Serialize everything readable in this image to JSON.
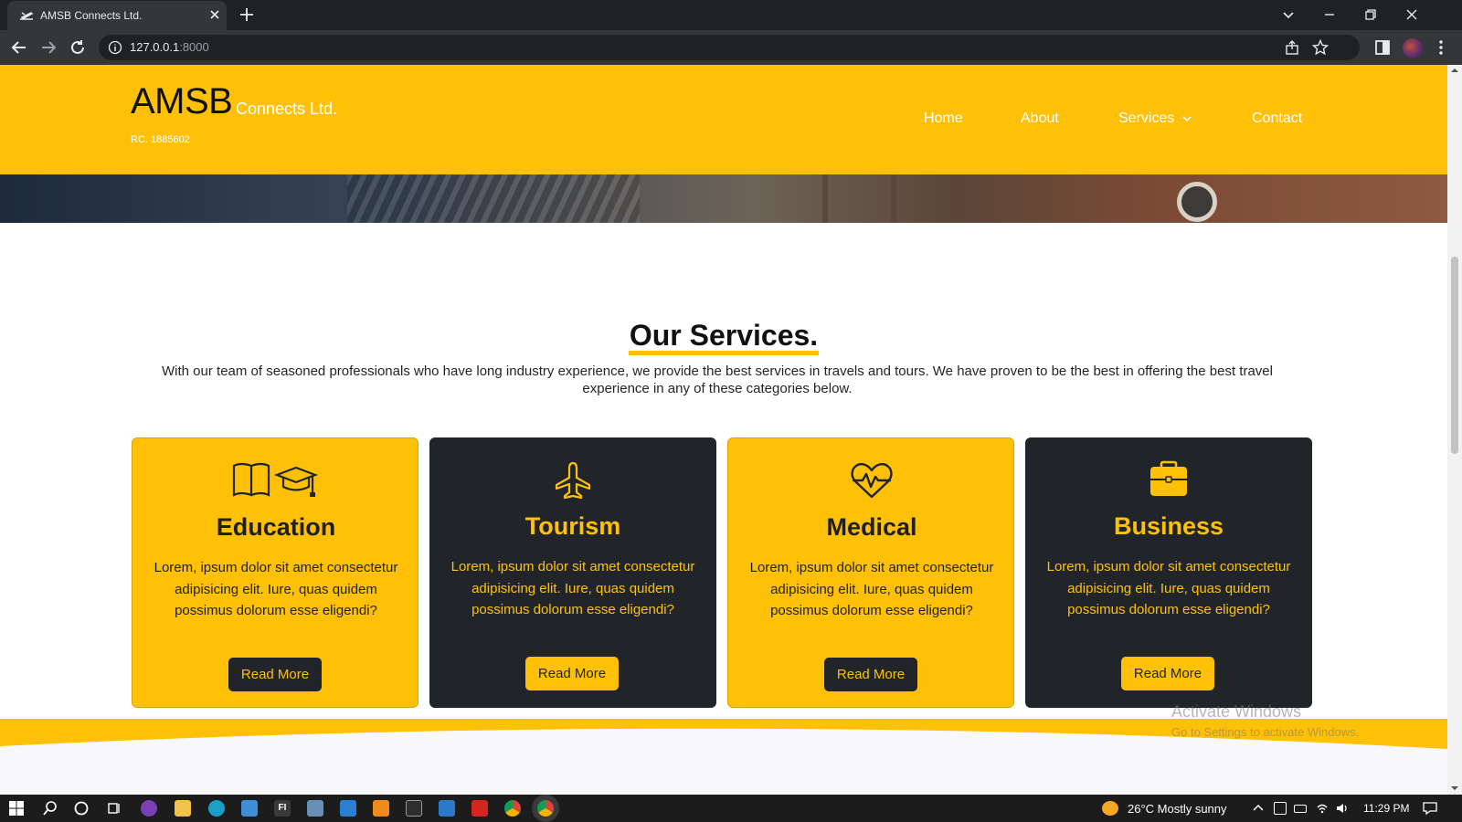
{
  "browser": {
    "tab_title": "AMSB Connects Ltd.",
    "url_host": "127.0.0.1",
    "url_port": ":8000"
  },
  "site": {
    "logo_main": "AMSB",
    "logo_sub": "Connects Ltd.",
    "logo_rc": "RC. 1885602",
    "nav": {
      "home": "Home",
      "about": "About",
      "services": "Services",
      "contact": "Contact"
    }
  },
  "services": {
    "title": "Our Services.",
    "description": "With our team of seasoned professionals who have long industry experience, we provide the best services in travels and tours. We have proven to be the best in offering the best travel experience in any of these categories below.",
    "cards": [
      {
        "title": "Education",
        "text": "Lorem, ipsum dolor sit amet consectetur adipisicing elit. Iure, quas quidem possimus dolorum esse eligendi?",
        "button": "Read More",
        "icon": "book-graduation-icon",
        "theme": "yellow"
      },
      {
        "title": "Tourism",
        "text": "Lorem, ipsum dolor sit amet consectetur adipisicing elit. Iure, quas quidem possimus dolorum esse eligendi?",
        "button": "Read More",
        "icon": "airplane-icon",
        "theme": "dark"
      },
      {
        "title": "Medical",
        "text": "Lorem, ipsum dolor sit amet consectetur adipisicing elit. Iure, quas quidem possimus dolorum esse eligendi?",
        "button": "Read More",
        "icon": "heart-pulse-icon",
        "theme": "yellow"
      },
      {
        "title": "Business",
        "text": "Lorem, ipsum dolor sit amet consectetur adipisicing elit. Iure, quas quidem possimus dolorum esse eligendi?",
        "button": "Read More",
        "icon": "briefcase-icon",
        "theme": "dark"
      }
    ]
  },
  "watermark": {
    "title": "Activate Windows",
    "subtitle": "Go to Settings to activate Windows."
  },
  "taskbar": {
    "weather": "26°C  Mostly sunny",
    "time": "11:29 PM"
  },
  "colors": {
    "brand_yellow": "#ffc107",
    "brand_dark": "#212529"
  }
}
